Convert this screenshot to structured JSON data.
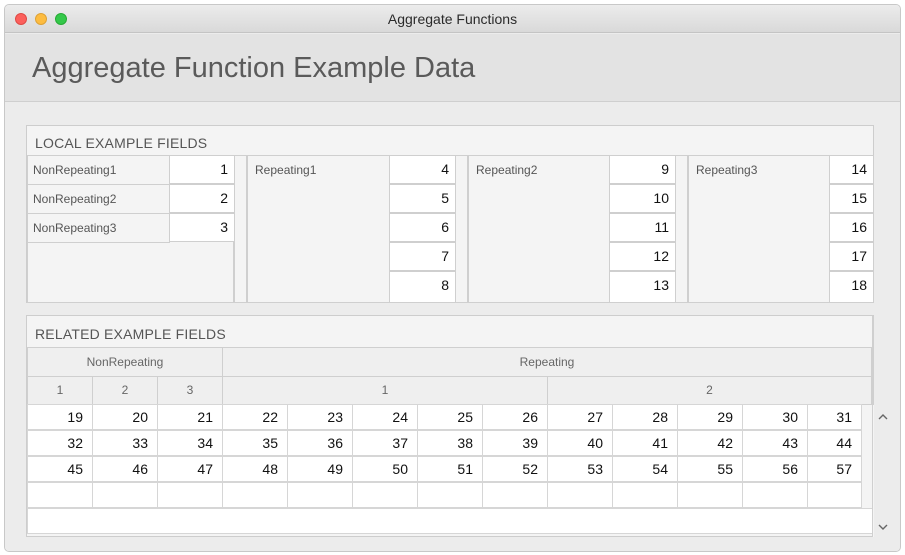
{
  "window": {
    "title": "Aggregate Functions"
  },
  "header": {
    "title": "Aggregate Function Example Data"
  },
  "local": {
    "section_label": "LOCAL EXAMPLE FIELDS",
    "nonrepeating": [
      {
        "label": "NonRepeating1",
        "value": "1"
      },
      {
        "label": "NonRepeating2",
        "value": "2"
      },
      {
        "label": "NonRepeating3",
        "value": "3"
      }
    ],
    "repeating": [
      {
        "label": "Repeating1",
        "values": [
          "4",
          "5",
          "6",
          "7",
          "8"
        ]
      },
      {
        "label": "Repeating2",
        "values": [
          "9",
          "10",
          "11",
          "12",
          "13"
        ]
      },
      {
        "label": "Repeating3",
        "values": [
          "14",
          "15",
          "16",
          "17",
          "18"
        ]
      }
    ]
  },
  "related": {
    "section_label": "RELATED EXAMPLE FIELDS",
    "group_headers": {
      "nonrepeating": "NonRepeating",
      "repeating": "Repeating"
    },
    "nonrepeating_cols": [
      "1",
      "2",
      "3"
    ],
    "repeating_cols": [
      "1",
      "2"
    ],
    "rows": [
      [
        "19",
        "20",
        "21",
        "22",
        "23",
        "24",
        "25",
        "26",
        "27",
        "28",
        "29",
        "30",
        "31"
      ],
      [
        "32",
        "33",
        "34",
        "35",
        "36",
        "37",
        "38",
        "39",
        "40",
        "41",
        "42",
        "43",
        "44"
      ],
      [
        "45",
        "46",
        "47",
        "48",
        "49",
        "50",
        "51",
        "52",
        "53",
        "54",
        "55",
        "56",
        "57"
      ],
      [
        "",
        "",
        "",
        "",
        "",
        "",
        "",
        "",
        "",
        "",
        "",
        "",
        ""
      ]
    ],
    "scroll_up_icon": "chevron-up-icon",
    "scroll_down_icon": "chevron-down-icon"
  },
  "colors": {
    "close": "#fc605c",
    "minimize": "#fdbc40",
    "maximize": "#34c84a"
  }
}
